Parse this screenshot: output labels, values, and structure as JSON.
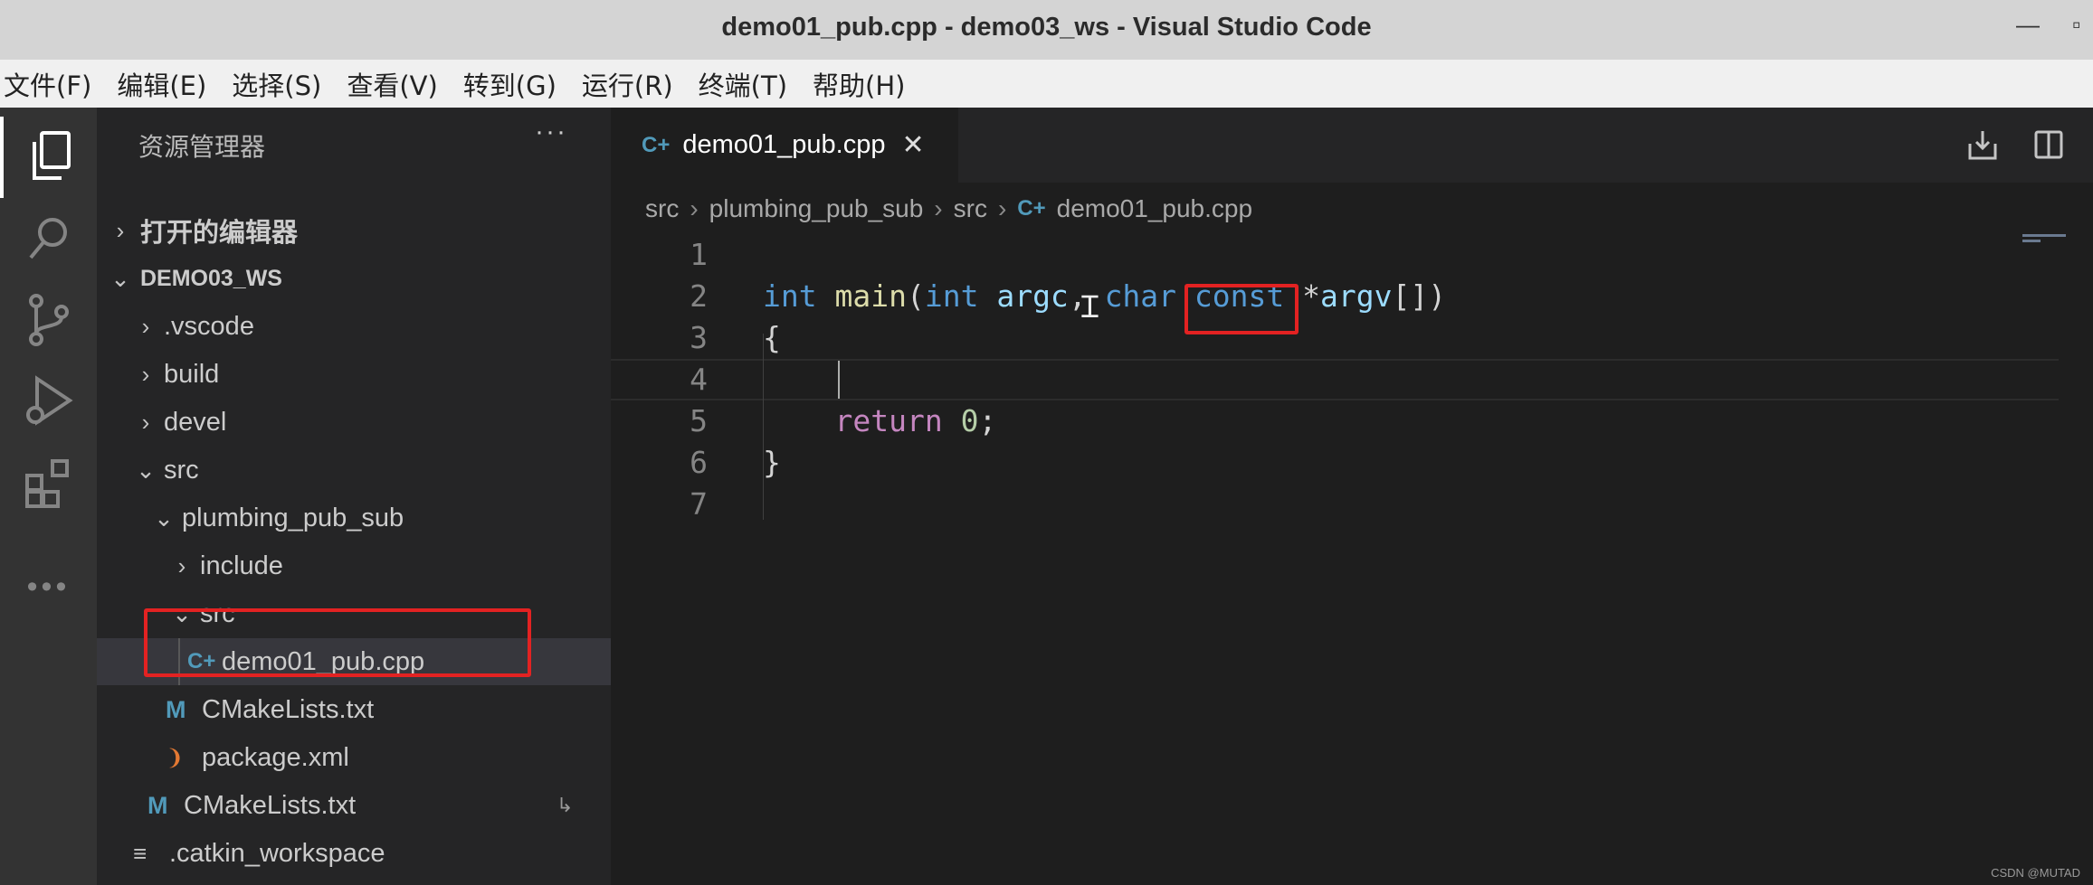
{
  "window": {
    "title": "demo01_pub.cpp - demo03_ws - Visual Studio Code"
  },
  "menu": [
    "文件(F)",
    "编辑(E)",
    "选择(S)",
    "查看(V)",
    "转到(G)",
    "运行(R)",
    "终端(T)",
    "帮助(H)"
  ],
  "activity_bar": [
    "explorer-icon",
    "search-icon",
    "source-control-icon",
    "run-debug-icon",
    "extensions-icon",
    "more-icon"
  ],
  "sidebar": {
    "header": "资源管理器",
    "more": "···",
    "open_editors": "打开的编辑器",
    "workspace": "DEMO03_WS",
    "tree": [
      {
        "label": ".vscode",
        "type": "folder",
        "expanded": false
      },
      {
        "label": "build",
        "type": "folder",
        "expanded": false
      },
      {
        "label": "devel",
        "type": "folder",
        "expanded": false
      },
      {
        "label": "src",
        "type": "folder",
        "expanded": true
      },
      {
        "label": "plumbing_pub_sub",
        "type": "folder",
        "expanded": true
      },
      {
        "label": "include",
        "type": "folder",
        "expanded": false
      },
      {
        "label": "src",
        "type": "folder",
        "expanded": true
      },
      {
        "label": "demo01_pub.cpp",
        "type": "cpp",
        "selected": true
      },
      {
        "label": "CMakeLists.txt",
        "type": "cmake"
      },
      {
        "label": "package.xml",
        "type": "xml"
      },
      {
        "label": "CMakeLists.txt",
        "type": "cmake"
      },
      {
        "label": ".catkin_workspace",
        "type": "text"
      }
    ]
  },
  "editor": {
    "tab": {
      "label": "demo01_pub.cpp",
      "close": "✕"
    },
    "breadcrumb": [
      "src",
      "plumbing_pub_sub",
      "src",
      "demo01_pub.cpp"
    ],
    "lines": [
      {
        "n": "1",
        "text": ""
      },
      {
        "n": "2",
        "text": "int main(int argc, char const *argv[])"
      },
      {
        "n": "3",
        "text": "{"
      },
      {
        "n": "4",
        "text": ""
      },
      {
        "n": "5",
        "text": "    return 0;"
      },
      {
        "n": "6",
        "text": "}"
      },
      {
        "n": "7",
        "text": ""
      }
    ]
  },
  "watermark": "CSDN @MUTAD",
  "colors": {
    "highlight": "#e32222",
    "accent_cpp": "#519aba",
    "cmake": "#519aba",
    "xml": "#e37933"
  }
}
